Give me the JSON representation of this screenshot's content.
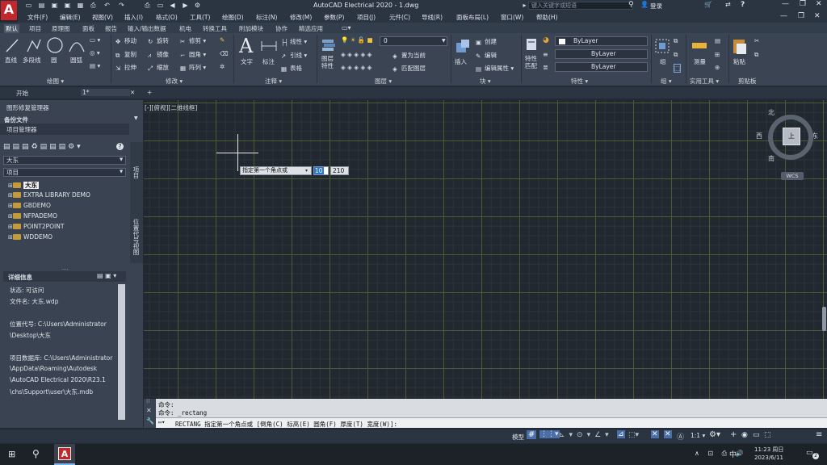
{
  "app": {
    "title": "AutoCAD Electrical 2020 - 1.dwg",
    "logo": "A",
    "search_placeholder": "键入关键字或短语",
    "user": "登录",
    "help": "?"
  },
  "menu": [
    "文件(F)",
    "编辑(E)",
    "视图(V)",
    "插入(I)",
    "格式(O)",
    "工具(T)",
    "绘图(D)",
    "标注(N)",
    "修改(M)",
    "参数(P)",
    "项目(J)",
    "元件(C)",
    "导线(R)",
    "面板布局(L)",
    "窗口(W)",
    "帮助(H)"
  ],
  "ribbon_tabs": [
    "默认",
    "项目",
    "原理图",
    "面板",
    "报告",
    "输入/输出数据",
    "机电",
    "转换工具",
    "附加模块",
    "协作",
    "精选应用"
  ],
  "ribbon": {
    "draw": {
      "label": "绘图 ▾",
      "line": "直线",
      "polyline": "多段线",
      "circle": "圆",
      "arc": "圆弧"
    },
    "modify": {
      "label": "修改 ▾",
      "items": [
        "移动",
        "旋转",
        "修剪 ▾",
        "复制",
        "镜像",
        "圆角 ▾",
        "拉伸",
        "缩放",
        "阵列 ▾"
      ]
    },
    "annotation": {
      "label": "注释 ▾",
      "text": "文字",
      "dim": "标注",
      "items": [
        "线性 ▾",
        "引线 ▾",
        "表格"
      ]
    },
    "layers": {
      "label": "图层 ▾",
      "layer_props": "图层\n特性",
      "current_layer": "0",
      "items": [
        "置为当前",
        "匹配图层"
      ]
    },
    "block": {
      "label": "块 ▾",
      "insert": "插入",
      "items": [
        "创建",
        "编辑",
        "编辑属性 ▾"
      ]
    },
    "properties": {
      "label": "特性 ▾",
      "match": "特性\n匹配",
      "color": "ByLayer",
      "linetype": "ByLayer",
      "lineweight": "ByLayer"
    },
    "groups": {
      "label": "组 ▾",
      "group": "组"
    },
    "utilities": {
      "label": "实用工具 ▾",
      "measure": "测量"
    },
    "clipboard": {
      "label": "剪贴板",
      "paste": "粘贴"
    }
  },
  "doc_tabs": [
    "开始",
    "1*"
  ],
  "left": {
    "manager_title": "图形修复管理器",
    "backup": "备份文件",
    "proj_manager": "项目管理器",
    "project_dropdown": "大东",
    "view_dropdown": "项目",
    "projects": [
      "大东",
      "EXTRA LIBRARY DEMO",
      "GBDEMO",
      "NFPADEMO",
      "POINT2POINT",
      "WDDEMO"
    ],
    "vstrip_label_top": "项目",
    "vstrip_label": "位置代号视图",
    "details_title": "详细信息",
    "details": [
      "状态: 可访问",
      "文件名: 大东.wdp",
      "",
      "位置代号: C:\\Users\\Administrator",
      "\\Desktop\\大东",
      "",
      "项目数据库: C:\\Users\\Administrator",
      "\\AppData\\Roaming\\Autodesk",
      "\\AutoCAD Electrical 2020\\R23.1",
      "\\chs\\Support\\user\\大东.mdb"
    ]
  },
  "viewport": {
    "label": "[-][俯视][二维线框]",
    "tooltip_prompt": "指定第一个角点或",
    "input_x": "10",
    "input_y": "210"
  },
  "viewcube": {
    "north": "北",
    "south": "南",
    "east": "东",
    "west": "西",
    "top": "上",
    "wcs": "WCS"
  },
  "command": {
    "history": [
      "命令:",
      "命令:  _rectang"
    ],
    "current": "RECTANG 指定第一个角点或 [倒角(C) 标高(E) 圆角(F) 厚度(T) 宽度(W)]:"
  },
  "status": {
    "model": "模型",
    "scale": "1:1 ▾"
  },
  "taskbar": {
    "time": "11:23 周日",
    "date": "2023/6/11",
    "ime": "中",
    "notif": "2"
  },
  "colors": {
    "accent": "#c4262b",
    "grid_major": "#4b5a32",
    "canvas": "#212830",
    "ribbon": "#3b4453"
  }
}
